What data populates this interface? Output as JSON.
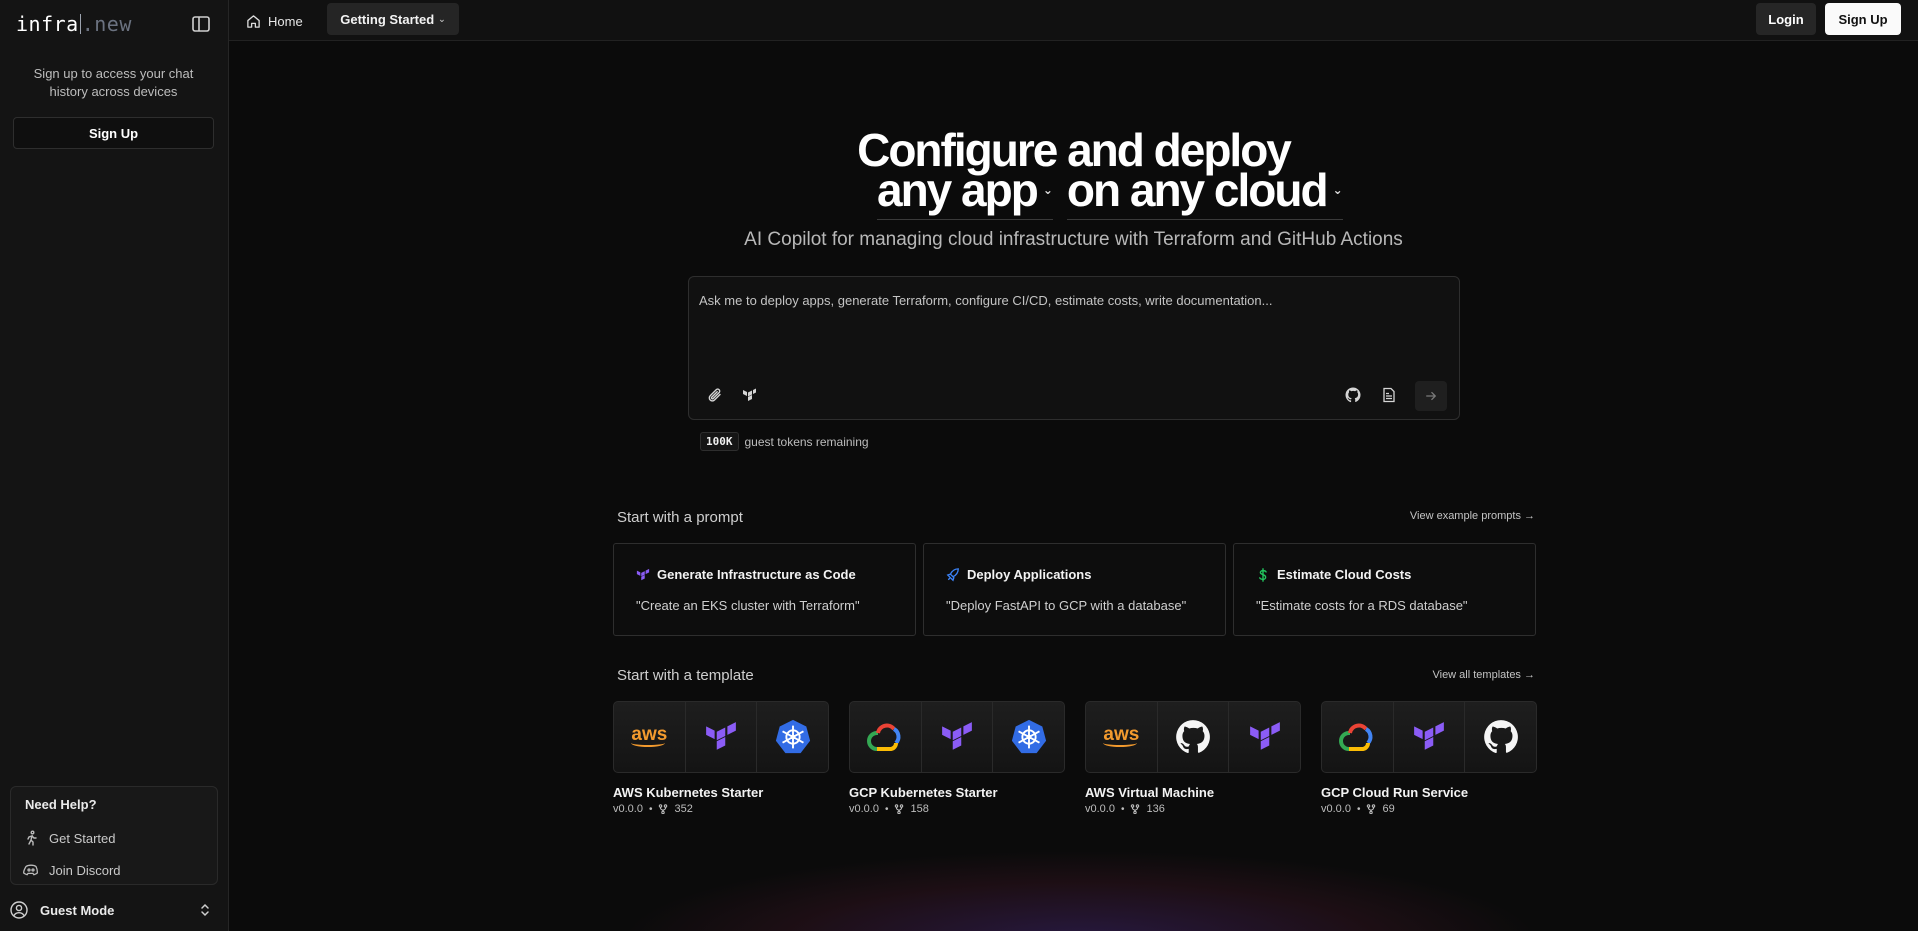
{
  "sidebar": {
    "logo_main": "infra",
    "logo_suffix": ".new",
    "signup_message": "Sign up to access your chat history across devices",
    "signup_label": "Sign Up",
    "help": {
      "title": "Need Help?",
      "items": [
        {
          "label": "Get Started",
          "icon": "run-icon"
        },
        {
          "label": "Join Discord",
          "icon": "discord-icon"
        }
      ]
    },
    "user": {
      "label": "Guest Mode",
      "icon": "user-circle-icon"
    }
  },
  "topbar": {
    "home_label": "Home",
    "getting_started_label": "Getting Started",
    "login_label": "Login",
    "signup_label": "Sign Up"
  },
  "hero": {
    "line1": "Configure and deploy",
    "app_select": "any app",
    "cloud_select": "on any cloud",
    "subtitle": "AI Copilot for managing cloud infrastructure with Terraform and GitHub Actions"
  },
  "prompt": {
    "placeholder": "Ask me to deploy apps, generate Terraform, configure CI/CD, estimate costs, write documentation...",
    "value": "",
    "tokens_badge": "100K",
    "tokens_text": "guest tokens remaining"
  },
  "prompts_section": {
    "title": "Start with a prompt",
    "link": "View example prompts →",
    "cards": [
      {
        "title": "Generate Infrastructure as Code",
        "quote": "\"Create an EKS cluster with Terraform\"",
        "icon": "terraform-icon",
        "color": "#8b5cf6"
      },
      {
        "title": "Deploy Applications",
        "quote": "\"Deploy FastAPI to GCP with a database\"",
        "icon": "rocket-icon",
        "color": "#3b82f6"
      },
      {
        "title": "Estimate Cloud Costs",
        "quote": "\"Estimate costs for a RDS database\"",
        "icon": "dollar-icon",
        "color": "#22c55e"
      }
    ]
  },
  "templates_section": {
    "title": "Start with a template",
    "link": "View all templates →",
    "templates": [
      {
        "name": "AWS Kubernetes Starter",
        "version": "v0.0.0",
        "forks": "352",
        "icons": [
          "aws-icon",
          "terraform-icon",
          "kubernetes-icon"
        ]
      },
      {
        "name": "GCP Kubernetes Starter",
        "version": "v0.0.0",
        "forks": "158",
        "icons": [
          "gcp-icon",
          "terraform-icon",
          "kubernetes-icon"
        ]
      },
      {
        "name": "AWS Virtual Machine",
        "version": "v0.0.0",
        "forks": "136",
        "icons": [
          "aws-icon",
          "github-icon",
          "terraform-icon"
        ]
      },
      {
        "name": "GCP Cloud Run Service",
        "version": "v0.0.0",
        "forks": "69",
        "icons": [
          "gcp-icon",
          "terraform-icon",
          "github-icon"
        ]
      }
    ]
  },
  "colors": {
    "background": "#0b0b0b",
    "sidebar": "#141414",
    "terraform": "#8b5cf6",
    "aws": "#f29a2e",
    "kubernetes": "#326ce5"
  }
}
